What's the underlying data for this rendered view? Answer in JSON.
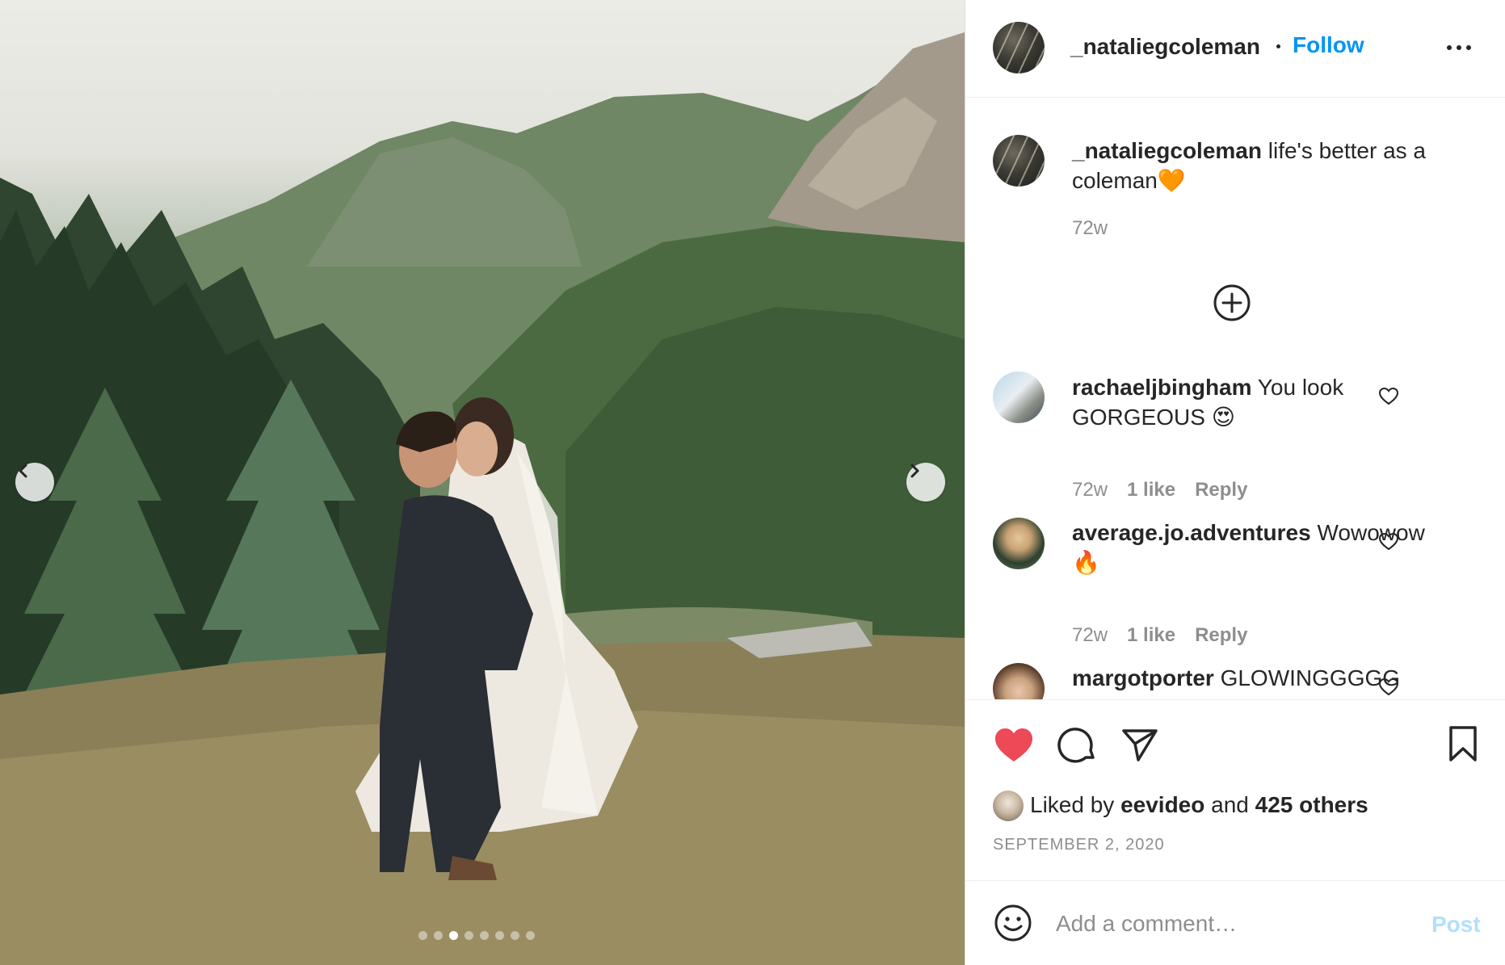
{
  "post": {
    "username": "_nataliegcoleman",
    "follow_label": "Follow",
    "more_icon": "more-horizontal-icon"
  },
  "caption": {
    "username": "_nataliegcoleman",
    "text": "life's better as a coleman",
    "emoji": "🧡",
    "time": "72w"
  },
  "comments": [
    {
      "username": "rachaeljbingham",
      "text": "You look GORGEOUS",
      "emoji": "😍",
      "time": "72w",
      "likes": "1 like",
      "reply": "Reply"
    },
    {
      "username": "average.jo.adventures",
      "text": "Wowowow",
      "emoji": "🔥",
      "time": "72w",
      "likes": "1 like",
      "reply": "Reply"
    },
    {
      "username": "margotporter",
      "text": "GLOWINGGGGG"
    }
  ],
  "likes": {
    "prefix": "Liked by",
    "user": "eevideo",
    "joiner": "and",
    "others": "425 others"
  },
  "date": "SEPTEMBER 2, 2020",
  "composer": {
    "placeholder": "Add a comment…",
    "post_label": "Post"
  },
  "carousel": {
    "total": 8,
    "active": 3
  },
  "colors": {
    "accent": "#0095f6",
    "like": "#ed4956",
    "post_disabled": "#b2dffc"
  }
}
